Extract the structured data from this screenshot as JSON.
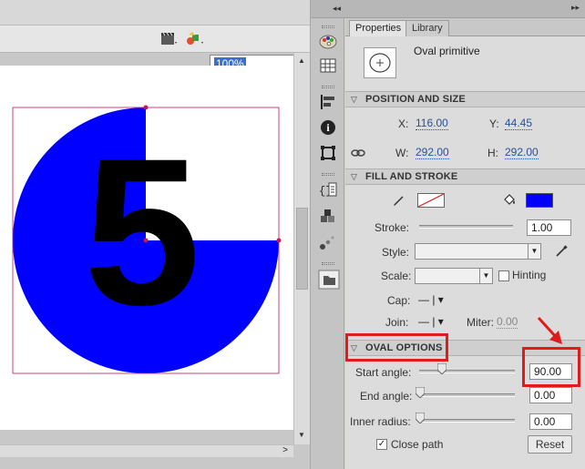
{
  "stage": {
    "zoom": "100%",
    "shape_fill_color": "#0000ff",
    "digit_text": "5"
  },
  "dock": {
    "collapse_label": "◂◂"
  },
  "panel": {
    "collapse_label": "▸▸",
    "tabs": [
      {
        "label": "Properties",
        "active": true
      },
      {
        "label": "Library",
        "active": false
      }
    ],
    "symbol_name": "Oval primitive",
    "position_and_size": {
      "title": "POSITION AND SIZE",
      "x_label": "X:",
      "x_value": "116.00",
      "y_label": "Y:",
      "y_value": "44.45",
      "w_label": "W:",
      "w_value": "292.00",
      "h_label": "H:",
      "h_value": "292.00"
    },
    "fill_and_stroke": {
      "title": "FILL AND STROKE",
      "fill_color": "#0000ff",
      "stroke_label": "Stroke:",
      "stroke_value": "1.00",
      "style_label": "Style:",
      "scale_label": "Scale:",
      "hinting_label": "Hinting",
      "cap_label": "Cap:",
      "join_label": "Join:",
      "miter_label": "Miter:",
      "miter_value": "0.00"
    },
    "oval_options": {
      "title": "OVAL OPTIONS",
      "start_angle_label": "Start angle:",
      "start_angle_value": "90.00",
      "end_angle_label": "End angle:",
      "end_angle_value": "0.00",
      "inner_radius_label": "Inner radius:",
      "inner_radius_value": "0.00",
      "close_path_label": "Close path",
      "close_path_checked": true,
      "reset_label": "Reset"
    }
  },
  "annotation_color": "#e01b1b"
}
